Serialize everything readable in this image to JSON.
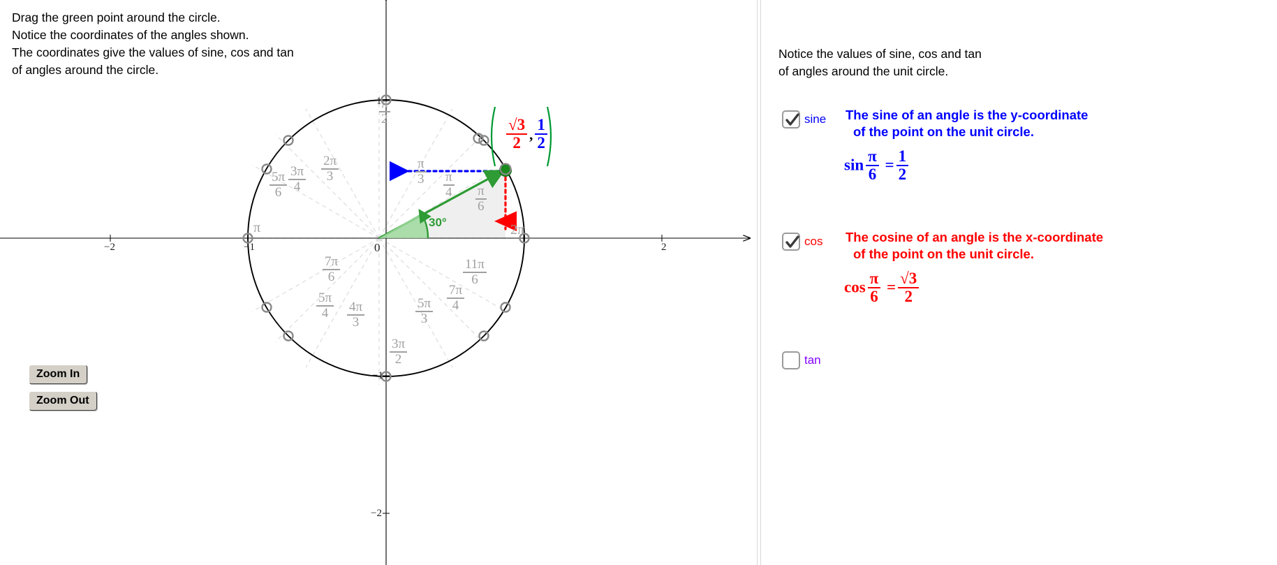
{
  "instructions": {
    "line1": "Drag the green point around the circle.",
    "line2": "Notice the coordinates of the angles shown.",
    "line3": "The coordinates give the values of sine, cos and tan",
    "line4": "of angles around the circle."
  },
  "toolbar": {
    "zoom_in_label": "Zoom In",
    "zoom_out_label": "Zoom Out"
  },
  "panel": {
    "intro_line1": "Notice the values of sine, cos and tan",
    "intro_line2": "of angles around the unit circle.",
    "sine": {
      "checkbox_label": "sine",
      "checked": true,
      "color": "#0000ff",
      "desc_line1": "The sine of an angle is the y-coordinate",
      "desc_line2": "of the point on the unit circle.",
      "eq_fn": "sin",
      "eq_arg_num": "π",
      "eq_arg_den": "6",
      "eq_eq": "=",
      "eq_val_num": "1",
      "eq_val_den": "2"
    },
    "cos": {
      "checkbox_label": "cos",
      "checked": true,
      "color": "#ff0000",
      "desc_line1": "The cosine of an angle is the x-coordinate",
      "desc_line2": "of the point on the unit circle.",
      "eq_fn": "cos",
      "eq_arg_num": "π",
      "eq_arg_den": "6",
      "eq_eq": "=",
      "eq_val_num": "√3",
      "eq_val_den": "2"
    },
    "tan": {
      "checkbox_label": "tan",
      "checked": false,
      "color": "#8000ff"
    }
  },
  "graph": {
    "origin_label": "0",
    "degree_label": "30°",
    "coordinate": {
      "open_paren": "(",
      "close_paren": ")",
      "comma": ",",
      "x_num": "√3",
      "x_den": "2",
      "y_num": "1",
      "y_den": "2",
      "x_color": "#ff0000",
      "y_color": "#0000ff",
      "paren_color": "#009933"
    },
    "x_ticks": [
      {
        "label": "−2",
        "x": -2
      },
      {
        "label": "−1",
        "x": -1
      },
      {
        "label": "2",
        "x": 2
      }
    ],
    "y_ticks": [
      {
        "label": "1",
        "y": 1
      },
      {
        "label": "−1",
        "y": -1
      },
      {
        "label": "−2",
        "y": -2
      }
    ],
    "axis_angle_labels": [
      {
        "text": "π",
        "at": "(-1,0)"
      },
      {
        "text": "2π",
        "at": "(1,0)"
      }
    ],
    "quadrant_angles": [
      {
        "num": "π",
        "den": "2",
        "degrees": 90
      },
      {
        "num": "2π",
        "den": "3",
        "degrees": 120
      },
      {
        "num": "3π",
        "den": "4",
        "degrees": 135
      },
      {
        "num": "5π",
        "den": "6",
        "degrees": 150
      },
      {
        "num": "7π",
        "den": "6",
        "degrees": 210
      },
      {
        "num": "5π",
        "den": "4",
        "degrees": 225
      },
      {
        "num": "4π",
        "den": "3",
        "degrees": 240
      },
      {
        "num": "3π",
        "den": "2",
        "degrees": 270
      },
      {
        "num": "5π",
        "den": "3",
        "degrees": 300
      },
      {
        "num": "7π",
        "den": "4",
        "degrees": 315
      },
      {
        "num": "11π",
        "den": "6",
        "degrees": 330
      },
      {
        "num": "π",
        "den": "3",
        "degrees": 60
      },
      {
        "num": "π",
        "den": "4",
        "degrees": 45
      },
      {
        "num": "π",
        "den": "6",
        "degrees": 30
      }
    ],
    "point_angle_degrees": 30,
    "point_x": 0.8660254,
    "point_y": 0.5,
    "colors": {
      "circle": "#000000",
      "radius": "#2e9b34",
      "point": "#1a8a1f",
      "sine_projection": "#0000ff",
      "cos_projection": "#ff0000",
      "marker_ring": "#8a8a8a",
      "dashed_spoke": "#dcdcdc",
      "sector_fill": "#eeeeee",
      "angle_arc_fill": "#9fd99f"
    }
  }
}
